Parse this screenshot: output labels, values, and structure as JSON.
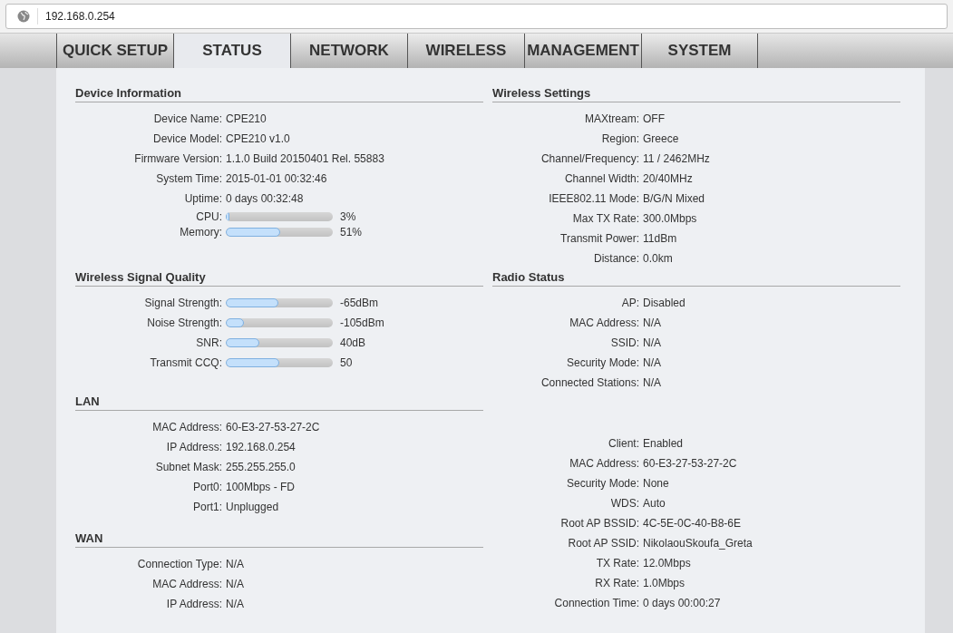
{
  "address_bar": {
    "url": "192.168.0.254"
  },
  "tabs": [
    {
      "label": "QUICK SETUP",
      "selected": false
    },
    {
      "label": "STATUS",
      "selected": true
    },
    {
      "label": "NETWORK",
      "selected": false
    },
    {
      "label": "WIRELESS",
      "selected": false
    },
    {
      "label": "MANAGEMENT",
      "selected": false
    },
    {
      "label": "SYSTEM",
      "selected": false
    }
  ],
  "left_column": [
    {
      "title": "Device Information",
      "rows": [
        {
          "kind": "text",
          "label": "Device Name:",
          "value": "CPE210"
        },
        {
          "kind": "text",
          "label": "Device Model:",
          "value": "CPE210 v1.0"
        },
        {
          "kind": "text",
          "label": "Firmware Version:",
          "value": "1.1.0 Build 20150401 Rel. 55883"
        },
        {
          "kind": "text",
          "label": "System Time:",
          "value": "2015-01-01 00:32:46"
        },
        {
          "kind": "text",
          "label": "Uptime:",
          "value": "0 days 00:32:48"
        },
        {
          "kind": "bar",
          "label": "CPU:",
          "level": 0.03,
          "value": "3%"
        },
        {
          "kind": "bar",
          "label": "Memory:",
          "level": 0.51,
          "value": "51%"
        }
      ]
    },
    {
      "title": "Wireless Signal Quality",
      "rows": [
        {
          "kind": "bar",
          "label": "Signal Strength:",
          "level": 0.49,
          "value": "-65dBm"
        },
        {
          "kind": "bar",
          "label": "Noise Strength:",
          "level": 0.17,
          "value": "-105dBm"
        },
        {
          "kind": "bar",
          "label": "SNR:",
          "level": 0.31,
          "value": "40dB"
        },
        {
          "kind": "bar",
          "label": "Transmit CCQ:",
          "level": 0.5,
          "value": "50"
        }
      ]
    },
    {
      "title": "LAN",
      "rows": [
        {
          "kind": "text",
          "label": "MAC Address:",
          "value": "60-E3-27-53-27-2C"
        },
        {
          "kind": "text",
          "label": "IP Address:",
          "value": "192.168.0.254"
        },
        {
          "kind": "text",
          "label": "Subnet Mask:",
          "value": "255.255.255.0"
        },
        {
          "kind": "text",
          "label": "Port0:",
          "value": "100Mbps - FD"
        },
        {
          "kind": "text",
          "label": "Port1:",
          "value": "Unplugged"
        }
      ]
    },
    {
      "title": "WAN",
      "rows": [
        {
          "kind": "text",
          "label": "Connection Type:",
          "value": "N/A"
        },
        {
          "kind": "text",
          "label": "MAC Address:",
          "value": "N/A"
        },
        {
          "kind": "text",
          "label": "IP Address:",
          "value": "N/A"
        }
      ]
    }
  ],
  "right_column": [
    {
      "title": "Wireless Settings",
      "rows": [
        {
          "kind": "text",
          "label": "MAXtream:",
          "value": "OFF"
        },
        {
          "kind": "text",
          "label": "Region:",
          "value": "Greece"
        },
        {
          "kind": "text",
          "label": "Channel/Frequency:",
          "value": "11 / 2462MHz"
        },
        {
          "kind": "text",
          "label": "Channel Width:",
          "value": "20/40MHz"
        },
        {
          "kind": "text",
          "label": "IEEE802.11 Mode:",
          "value": "B/G/N Mixed"
        },
        {
          "kind": "text",
          "label": "Max TX Rate:",
          "value": "300.0Mbps"
        },
        {
          "kind": "text",
          "label": "Transmit Power:",
          "value": "11dBm"
        },
        {
          "kind": "text",
          "label": "Distance:",
          "value": "0.0km"
        }
      ]
    },
    {
      "title": "Radio Status",
      "rows": [
        {
          "kind": "text",
          "label": "AP:",
          "value": "Disabled"
        },
        {
          "kind": "text",
          "label": "MAC Address:",
          "value": "N/A"
        },
        {
          "kind": "text",
          "label": "SSID:",
          "value": "N/A"
        },
        {
          "kind": "text",
          "label": "Security Mode:",
          "value": "N/A"
        },
        {
          "kind": "text",
          "label": "Connected Stations:",
          "value": "N/A"
        }
      ]
    },
    {
      "rows": [
        {
          "kind": "text",
          "label": "Client:",
          "value": "Enabled"
        },
        {
          "kind": "text",
          "label": "MAC Address:",
          "value": "60-E3-27-53-27-2C"
        },
        {
          "kind": "text",
          "label": "Security Mode:",
          "value": "None"
        },
        {
          "kind": "text",
          "label": "WDS:",
          "value": "Auto"
        },
        {
          "kind": "text",
          "label": "Root AP BSSID:",
          "value": "4C-5E-0C-40-B8-6E"
        },
        {
          "kind": "text",
          "label": "Root AP SSID:",
          "value": "NikolaouSkoufa_Greta"
        },
        {
          "kind": "text",
          "label": "TX Rate:",
          "value": "12.0Mbps"
        },
        {
          "kind": "text",
          "label": "RX Rate:",
          "value": "1.0Mbps"
        },
        {
          "kind": "text",
          "label": "Connection Time:",
          "value": "0 days 00:00:27"
        }
      ]
    }
  ]
}
